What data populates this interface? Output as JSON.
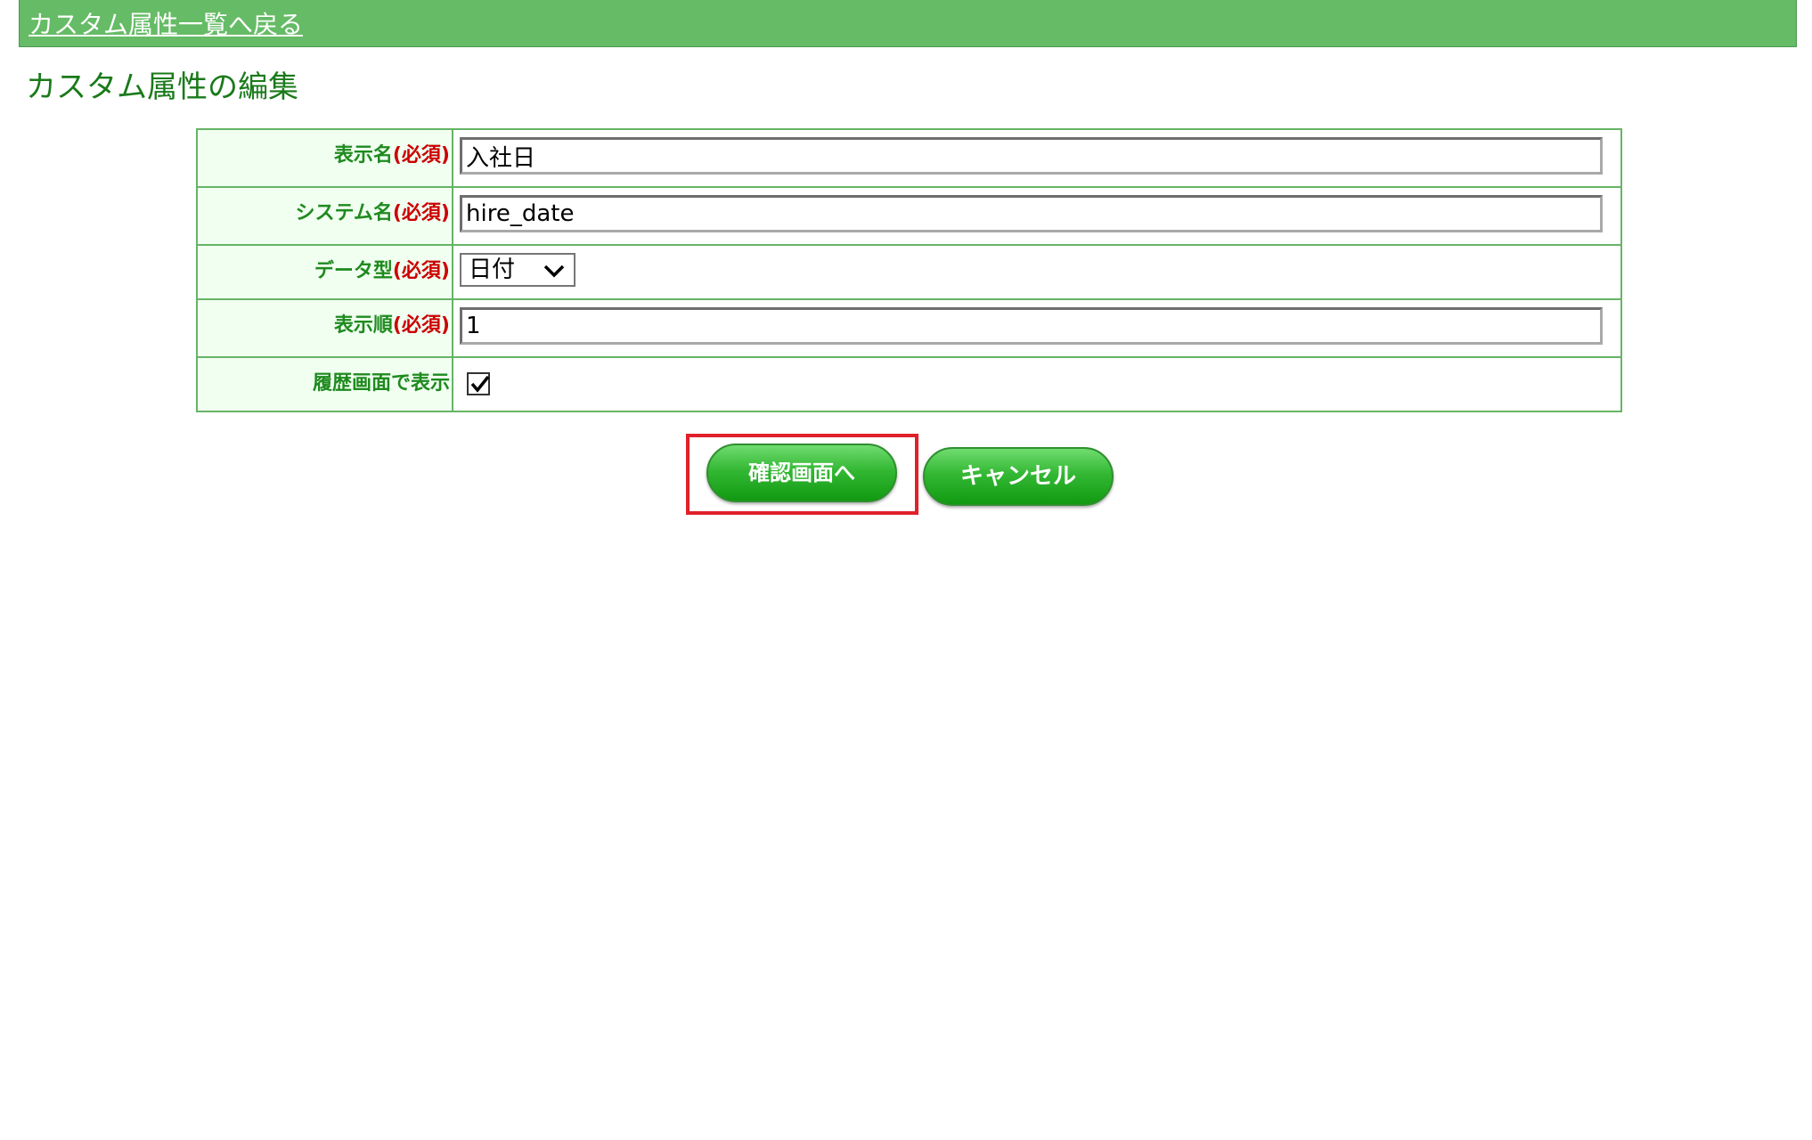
{
  "header": {
    "back_link": "カスタム属性一覧へ戻る"
  },
  "page_title": "カスタム属性の編集",
  "form": {
    "required_marker": "(必須)",
    "display_name": {
      "label": "表示名",
      "value": "入社日"
    },
    "system_name": {
      "label": "システム名",
      "value": "hire_date"
    },
    "data_type": {
      "label": "データ型",
      "selected": "日付"
    },
    "display_order": {
      "label": "表示順",
      "value": "1"
    },
    "show_in_history": {
      "label": "履歴画面で表示",
      "checked": true
    }
  },
  "buttons": {
    "confirm": "確認画面へ",
    "cancel": "キャンセル"
  },
  "colors": {
    "topbar": "#66bb66",
    "title_green": "#1a7a1a",
    "required_red": "#cc0000",
    "highlight_red": "#e0202a"
  }
}
